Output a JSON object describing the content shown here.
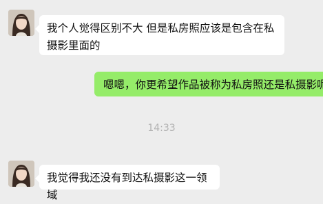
{
  "chat": {
    "messages": [
      {
        "side": "incoming",
        "text": "我个人觉得区别不大 但是私房照应该是包含在私摄影里面的"
      },
      {
        "side": "outgoing",
        "text": "嗯嗯，你更希望作品被称为私房照还是私摄影呢?"
      },
      {
        "side": "incoming",
        "text": "我觉得我还没有到达私摄影这一领域"
      }
    ],
    "timestamp": "14:33"
  },
  "colors": {
    "background": "#ededed",
    "incoming_bubble": "#ffffff",
    "outgoing_bubble": "#95ec69",
    "timestamp": "#b2b2b2"
  },
  "icons": {
    "avatar": "contact-avatar-photo"
  }
}
